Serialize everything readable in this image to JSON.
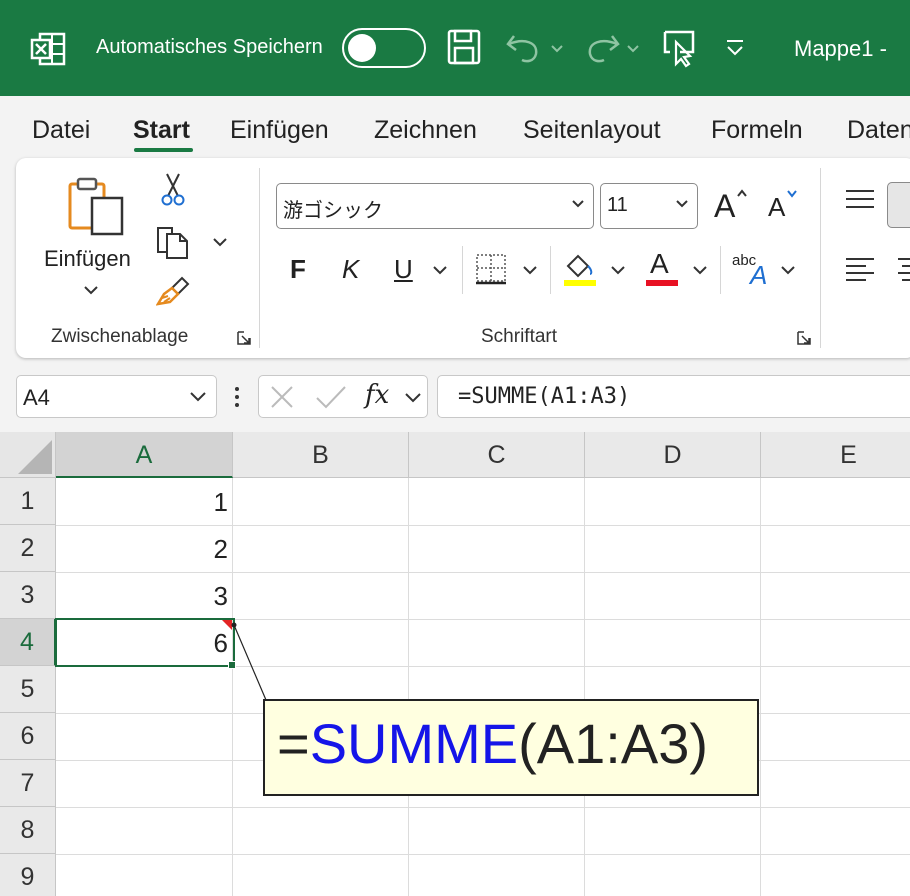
{
  "titlebar": {
    "autosave_label": "Automatisches Speichern",
    "doc_title": "Mappe1  -",
    "autosave_on": false
  },
  "tabs": [
    "Datei",
    "Start",
    "Einfügen",
    "Zeichnen",
    "Seitenlayout",
    "Formeln",
    "Daten"
  ],
  "active_tab": "Start",
  "ribbon": {
    "clipboard": {
      "paste_label": "Einfügen",
      "group_label": "Zwischenablage"
    },
    "font": {
      "font_name": "游ゴシック",
      "font_size": "11",
      "group_label": "Schriftart",
      "bold_glyph": "F",
      "italic_glyph": "K",
      "underline_glyph": "U",
      "grow_glyph": "A",
      "shrink_glyph": "A",
      "color_glyph": "A",
      "abc_label": "abc",
      "highlight_color": "#ffff00",
      "font_color": "#e81123"
    }
  },
  "formula_bar": {
    "name_box": "A4",
    "fx_label": "fx",
    "formula": "=SUMME(A1:A3)"
  },
  "sheet": {
    "columns": [
      "A",
      "B",
      "C",
      "D",
      "E"
    ],
    "rows": [
      "1",
      "2",
      "3",
      "4",
      "5",
      "6",
      "7",
      "8",
      "9"
    ],
    "cells": {
      "A1": "1",
      "A2": "2",
      "A3": "3",
      "A4": "6"
    },
    "active_cell": "A4"
  },
  "callout": {
    "prefix": "=",
    "function_name": "SUMME",
    "args": "(A1:A3)",
    "function_color": "#1515e8",
    "background": "#ffffe0"
  },
  "colors": {
    "excel_green": "#1a7a43",
    "selection_green": "#1a6b3c"
  }
}
